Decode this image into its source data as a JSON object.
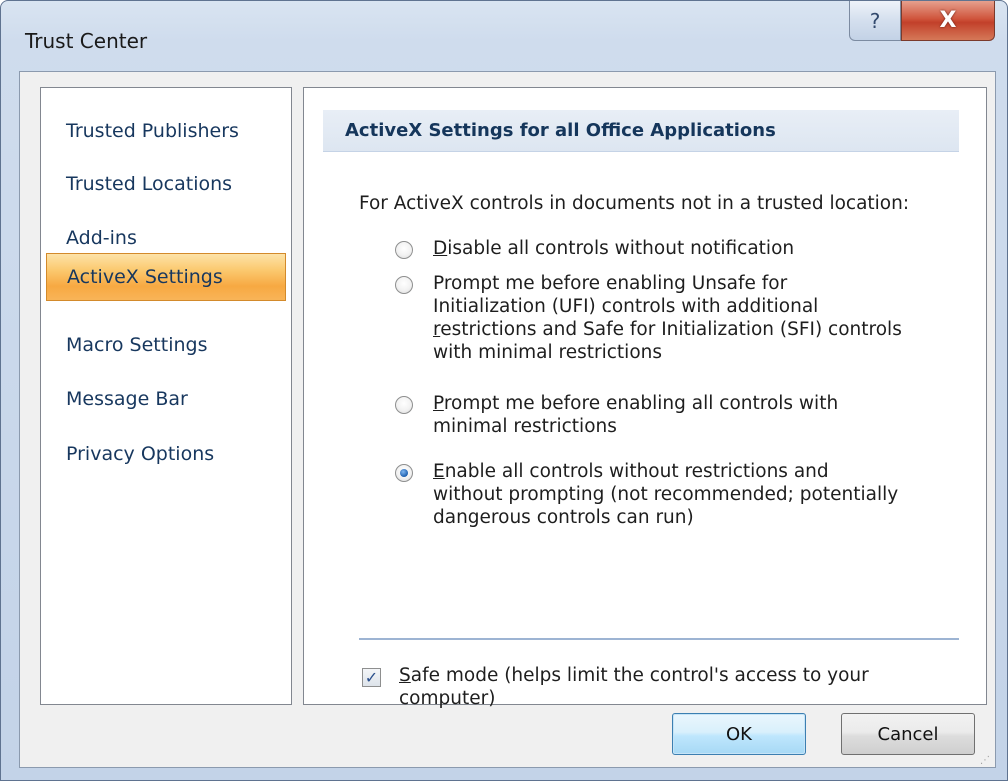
{
  "window": {
    "title": "Trust Center",
    "help_icon": "?",
    "close_icon": "X"
  },
  "sidebar": {
    "items": [
      {
        "label": "Trusted Publishers",
        "selected": false
      },
      {
        "label": "Trusted Locations",
        "selected": false
      },
      {
        "label": "Add-ins",
        "selected": false
      },
      {
        "label": "ActiveX Settings",
        "selected": true
      },
      {
        "label": "Macro Settings",
        "selected": false
      },
      {
        "label": "Message Bar",
        "selected": false
      },
      {
        "label": "Privacy Options",
        "selected": false
      }
    ]
  },
  "main": {
    "section_title": "ActiveX Settings for all Office Applications",
    "intro": "For ActiveX controls in documents not in a trusted location:",
    "options": [
      {
        "accel": "D",
        "rest": "isable all controls without notification",
        "checked": false
      },
      {
        "line1": "Prompt me before enabling Unsafe for",
        "line2": "Initialization (UFI) controls with additional",
        "line3_accel": "r",
        "line3_rest": "estrictions and Safe for Initialization (SFI) controls",
        "line4": "with minimal restrictions",
        "checked": false
      },
      {
        "accel": "P",
        "rest": "rompt me before enabling all controls with",
        "line2": "minimal restrictions",
        "checked": false
      },
      {
        "accel": "E",
        "rest": "nable all controls without restrictions and",
        "line2": "without prompting (not recommended; potentially",
        "line3": "dangerous controls can run)",
        "checked": true
      }
    ],
    "safe_mode": {
      "accel": "S",
      "rest": "afe mode (helps limit the control's access to your",
      "line2": "computer)",
      "checked": true,
      "check_glyph": "✓"
    }
  },
  "buttons": {
    "ok": "OK",
    "cancel": "Cancel"
  },
  "colors": {
    "selection": "#f7a942",
    "header_bg": "#dde6f1",
    "link_text": "#17375e",
    "close_button": "#c2402a"
  }
}
